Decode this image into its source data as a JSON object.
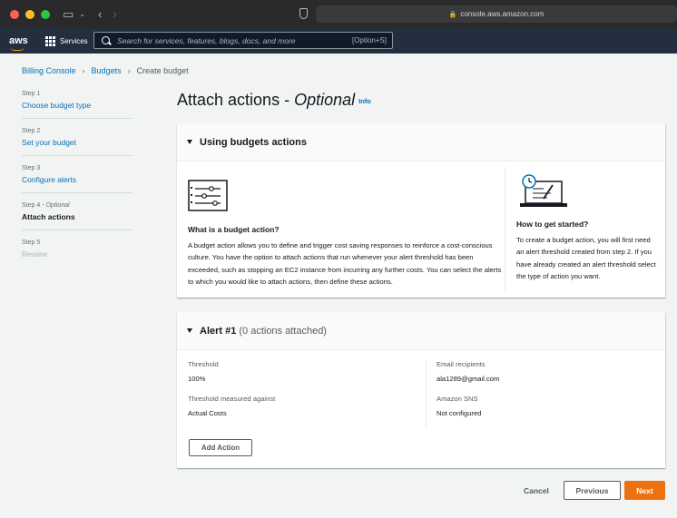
{
  "browser": {
    "url": "console.aws.amazon.com"
  },
  "aws_nav": {
    "logo": "aws",
    "services_label": "Services",
    "search_placeholder": "Search for services, features, blogs, docs, and more",
    "search_shortcut": "[Option+S]"
  },
  "breadcrumb": {
    "items": [
      "Billing Console",
      "Budgets",
      "Create budget"
    ]
  },
  "steps": [
    {
      "num": "Step 1",
      "label": "Choose budget type"
    },
    {
      "num": "Step 2",
      "label": "Set your budget"
    },
    {
      "num": "Step 3",
      "label": "Configure alerts"
    },
    {
      "num": "Step 4",
      "num_suffix": "Optional",
      "label": "Attach actions"
    },
    {
      "num": "Step 5",
      "label": "Review"
    }
  ],
  "page": {
    "title_main": "Attach actions - ",
    "title_optional": "Optional",
    "info_link": "Info"
  },
  "using_panel": {
    "header": "Using budgets actions",
    "left": {
      "title": "What is a budget action?",
      "body": "A budget action allows you to define and trigger cost saving responses to reinforce a cost-conscious culture. You have the option to attach actions that run whenever your alert threshold has been exceeded, such as stopping an EC2 instance from incurring any further costs. You can select the alerts to which you would like to attach actions, then define these actions."
    },
    "right": {
      "title": "How to get started?",
      "body": "To create a budget action, you will first need an alert threshold created from step 2. If you have already created an alert threshold select the type of action you want."
    }
  },
  "alert_panel": {
    "header": "Alert #1",
    "header_sub": "(0 actions attached)",
    "threshold_label": "Threshold",
    "threshold_value": "100%",
    "measured_label": "Threshold measured against",
    "measured_value": "Actual Costs",
    "email_label": "Email recipients",
    "email_value": "ala1289@gmail.com",
    "sns_label": "Amazon SNS",
    "sns_value": "Not configured",
    "add_action_label": "Add Action"
  },
  "footer": {
    "cancel": "Cancel",
    "previous": "Previous",
    "next": "Next"
  }
}
